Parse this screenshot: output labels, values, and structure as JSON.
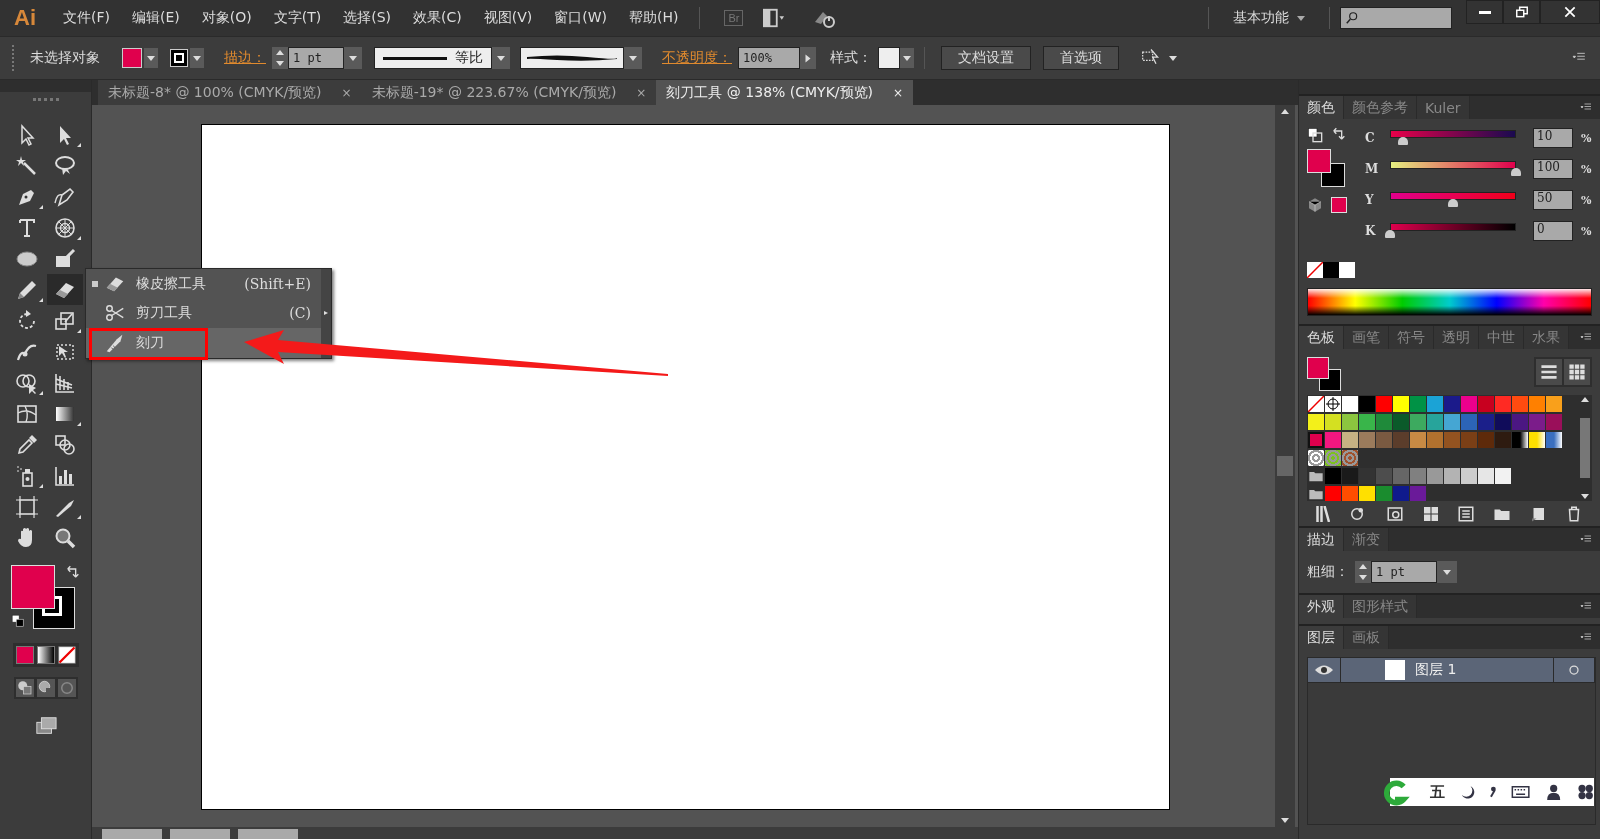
{
  "menu_bar": {
    "logo": "Ai",
    "menus": [
      "文件(F)",
      "编辑(E)",
      "对象(O)",
      "文字(T)",
      "选择(S)",
      "效果(C)",
      "视图(V)",
      "窗口(W)",
      "帮助(H)"
    ],
    "bridge": "Br",
    "workspace": "基本功能"
  },
  "control_bar": {
    "selection": "未选择对象",
    "stroke_label": "描边：",
    "stroke_weight": "1 pt",
    "stroke_profile": "等比",
    "opacity_label": "不透明度：",
    "opacity": "100%",
    "style_label": "样式：",
    "buttons": [
      "文档设置",
      "首选项"
    ]
  },
  "document_tabs": [
    {
      "label": "未标题-8* @ 100% (CMYK/预览)",
      "close": "×",
      "selected": false
    },
    {
      "label": "未标题-19* @ 223.67% (CMYK/预览)",
      "close": "×",
      "selected": false
    },
    {
      "label": "刻刀工具 @ 138% (CMYK/预览)",
      "close": "×",
      "selected": true
    }
  ],
  "tools": [
    {
      "kind": "selection",
      "selected": false
    },
    {
      "kind": "direct-selection",
      "selected": false
    },
    {
      "kind": "magic-wand",
      "selected": false
    },
    {
      "kind": "lasso",
      "selected": false
    },
    {
      "kind": "pen",
      "selected": false
    },
    {
      "kind": "curvature-pen",
      "selected": false
    },
    {
      "kind": "type",
      "selected": false
    },
    {
      "kind": "polar-grid",
      "selected": false
    },
    {
      "kind": "ellipse",
      "selected": false
    },
    {
      "kind": "brush",
      "selected": false
    },
    {
      "kind": "pencil",
      "selected": false
    },
    {
      "kind": "eraser",
      "selected": true
    },
    {
      "kind": "rotate",
      "selected": false
    },
    {
      "kind": "scale",
      "selected": false
    },
    {
      "kind": "warp",
      "selected": false
    },
    {
      "kind": "free-transform",
      "selected": false
    },
    {
      "kind": "shape-builder",
      "selected": false
    },
    {
      "kind": "perspective-grid",
      "selected": false
    },
    {
      "kind": "mesh",
      "selected": false
    },
    {
      "kind": "gradient",
      "selected": false
    },
    {
      "kind": "eyedropper",
      "selected": false
    },
    {
      "kind": "blend",
      "selected": false
    },
    {
      "kind": "symbol-sprayer",
      "selected": false
    },
    {
      "kind": "graph",
      "selected": false
    },
    {
      "kind": "artboard",
      "selected": false
    },
    {
      "kind": "slice",
      "selected": false
    },
    {
      "kind": "hand",
      "selected": false
    },
    {
      "kind": "zoom",
      "selected": false
    }
  ],
  "flyout_menu": [
    {
      "kind": "eraser",
      "label": "橡皮擦工具",
      "shortcut": "(Shift+E)",
      "current": true,
      "selected": false
    },
    {
      "kind": "scissors",
      "label": "剪刀工具",
      "shortcut": "(C)",
      "current": false,
      "selected": false
    },
    {
      "kind": "knife",
      "label": "刻刀",
      "current": false,
      "selected": true
    }
  ],
  "color_panel": {
    "tabs": [
      {
        "label": "颜色",
        "selected": true
      },
      {
        "label": "颜色参考",
        "selected": false
      },
      {
        "label": "Kuler",
        "selected": false
      }
    ],
    "channels": [
      {
        "name": "C",
        "level": 0.1,
        "value": "10",
        "unit": "%"
      },
      {
        "name": "M",
        "level": 1,
        "value": "100",
        "unit": "%"
      },
      {
        "name": "Y",
        "level": 0.5,
        "value": "50",
        "unit": "%"
      },
      {
        "name": "K",
        "level": 0,
        "value": "0",
        "unit": "%"
      }
    ]
  },
  "swatches_panel": {
    "tabs": [
      {
        "label": "色板",
        "selected": true
      },
      {
        "label": "画笔",
        "selected": false
      },
      {
        "label": "符号",
        "selected": false
      },
      {
        "label": "透明",
        "selected": false
      },
      {
        "label": "中世",
        "selected": false
      },
      {
        "label": "水果",
        "selected": false
      }
    ],
    "rows": [
      [
        {
          "kind": "none"
        },
        {
          "kind": "registration"
        },
        {
          "kind": "color",
          "color": "#ffffff"
        },
        {
          "kind": "color",
          "color": "#000000"
        },
        {
          "kind": "color",
          "color": "#ff0000"
        },
        {
          "kind": "color",
          "color": "#ffff00"
        },
        {
          "kind": "color",
          "color": "#009245"
        },
        {
          "kind": "color",
          "color": "#1ba3d6"
        },
        {
          "kind": "color",
          "color": "#1b1a8a"
        },
        {
          "kind": "color",
          "color": "#ec008c"
        },
        {
          "kind": "color",
          "color": "#c8001f"
        },
        {
          "kind": "color",
          "color": "#ff2a23"
        },
        {
          "kind": "color",
          "color": "#ff4b10"
        },
        {
          "kind": "color",
          "color": "#ff8000"
        },
        {
          "kind": "color",
          "color": "#f9a01b"
        }
      ],
      [
        {
          "kind": "color",
          "color": "#f3f01a"
        },
        {
          "kind": "color",
          "color": "#d4e021"
        },
        {
          "kind": "color",
          "color": "#8cc63f"
        },
        {
          "kind": "color",
          "color": "#39b54a"
        },
        {
          "kind": "color",
          "color": "#1f8a3a"
        },
        {
          "kind": "color",
          "color": "#0b5a2a"
        },
        {
          "kind": "color",
          "color": "#3daa5f"
        },
        {
          "kind": "color",
          "color": "#27a49b"
        },
        {
          "kind": "color",
          "color": "#45a6d3"
        },
        {
          "kind": "color",
          "color": "#2c64b7"
        },
        {
          "kind": "color",
          "color": "#1b1f8a"
        },
        {
          "kind": "color",
          "color": "#100c5a"
        },
        {
          "kind": "color",
          "color": "#4b1782"
        },
        {
          "kind": "color",
          "color": "#7b1c8a"
        },
        {
          "kind": "color",
          "color": "#9a0f5a"
        }
      ],
      [
        {
          "kind": "color",
          "color": "#e0004d",
          "selected": true
        },
        {
          "kind": "color",
          "color": "#f21780"
        },
        {
          "kind": "color",
          "color": "#c7b283"
        },
        {
          "kind": "color",
          "color": "#9b7b5c"
        },
        {
          "kind": "color",
          "color": "#7a5a41"
        },
        {
          "kind": "color",
          "color": "#5b3d2b"
        },
        {
          "kind": "color",
          "color": "#c78a44"
        },
        {
          "kind": "color",
          "color": "#b1712e"
        },
        {
          "kind": "color",
          "color": "#935320"
        },
        {
          "kind": "color",
          "color": "#7a3f16"
        },
        {
          "kind": "color",
          "color": "#5e2a0a"
        },
        {
          "kind": "color",
          "color": "#2e1b10"
        },
        {
          "kind": "gradient",
          "color": "#000000"
        },
        {
          "kind": "gradient",
          "color": "#ffe000"
        },
        {
          "kind": "gradient",
          "color": "#3a6fc0"
        }
      ],
      [
        {
          "kind": "pattern",
          "color": "#ffffff"
        },
        {
          "kind": "pattern",
          "color": "#7cc21e"
        },
        {
          "kind": "pattern",
          "color": "#a0522d"
        }
      ],
      [
        {
          "kind": "folder"
        },
        {
          "kind": "color",
          "color": "#000000"
        },
        {
          "kind": "color",
          "color": "#1a1a1a"
        },
        {
          "kind": "color",
          "color": "#333333"
        },
        {
          "kind": "color",
          "color": "#4d4d4d"
        },
        {
          "kind": "color",
          "color": "#666666"
        },
        {
          "kind": "color",
          "color": "#808080"
        },
        {
          "kind": "color",
          "color": "#999999"
        },
        {
          "kind": "color",
          "color": "#b3b3b3"
        },
        {
          "kind": "color",
          "color": "#cccccc"
        },
        {
          "kind": "color",
          "color": "#e6e6e6"
        },
        {
          "kind": "color",
          "color": "#f2f2f2"
        }
      ],
      [
        {
          "kind": "folder"
        },
        {
          "kind": "color",
          "color": "#ff0000"
        },
        {
          "kind": "color",
          "color": "#ff4d00"
        },
        {
          "kind": "color",
          "color": "#ffe000"
        },
        {
          "kind": "color",
          "color": "#1a8c2e"
        },
        {
          "kind": "color",
          "color": "#0f1a8c"
        },
        {
          "kind": "color",
          "color": "#6a1a99"
        }
      ]
    ]
  },
  "stroke_panel": {
    "tabs": [
      {
        "label": "描边",
        "selected": true
      },
      {
        "label": "渐变",
        "selected": false
      }
    ],
    "weight_label": "粗细：",
    "weight": "1 pt"
  },
  "appearance_panel": {
    "tabs": [
      {
        "label": "外观",
        "selected": true
      },
      {
        "label": "图形样式",
        "selected": false
      }
    ]
  },
  "layers_panel": {
    "tabs": [
      {
        "label": "图层",
        "selected": true
      },
      {
        "label": "画板",
        "selected": false
      }
    ],
    "layers": [
      {
        "name": "图层 1",
        "visible": true,
        "selected": true
      }
    ]
  },
  "ime_bar": {
    "mode": "五"
  }
}
